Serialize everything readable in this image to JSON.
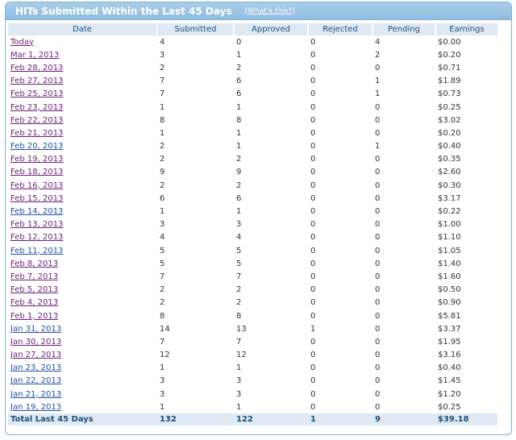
{
  "panel": {
    "title": "HITs Submitted Within the Last 45 Days",
    "whats_this": "(What's this?)"
  },
  "table": {
    "headers": [
      "Date",
      "Submitted",
      "Approved",
      "Rejected",
      "Pending",
      "Earnings"
    ],
    "rows": [
      {
        "date": "Today",
        "submitted": "4",
        "approved": "0",
        "rejected": "0",
        "pending": "4",
        "earnings": "$0.00"
      },
      {
        "date": "Mar 1, 2013",
        "submitted": "3",
        "approved": "1",
        "rejected": "0",
        "pending": "2",
        "earnings": "$0.20"
      },
      {
        "date": "Feb 28, 2013",
        "submitted": "2",
        "approved": "2",
        "rejected": "0",
        "pending": "0",
        "earnings": "$0.71"
      },
      {
        "date": "Feb 27, 2013",
        "submitted": "7",
        "approved": "6",
        "rejected": "0",
        "pending": "1",
        "earnings": "$1.89"
      },
      {
        "date": "Feb 25, 2013",
        "submitted": "7",
        "approved": "6",
        "rejected": "0",
        "pending": "1",
        "earnings": "$0.73"
      },
      {
        "date": "Feb 23, 2013",
        "submitted": "1",
        "approved": "1",
        "rejected": "0",
        "pending": "0",
        "earnings": "$0.25"
      },
      {
        "date": "Feb 22, 2013",
        "submitted": "8",
        "approved": "8",
        "rejected": "0",
        "pending": "0",
        "earnings": "$3.02"
      },
      {
        "date": "Feb 21, 2013",
        "submitted": "1",
        "approved": "1",
        "rejected": "0",
        "pending": "0",
        "earnings": "$0.20"
      },
      {
        "date": "Feb 20, 2013",
        "submitted": "2",
        "approved": "1",
        "rejected": "0",
        "pending": "1",
        "earnings": "$0.40"
      },
      {
        "date": "Feb 19, 2013",
        "submitted": "2",
        "approved": "2",
        "rejected": "0",
        "pending": "0",
        "earnings": "$0.35"
      },
      {
        "date": "Feb 18, 2013",
        "submitted": "9",
        "approved": "9",
        "rejected": "0",
        "pending": "0",
        "earnings": "$2.60"
      },
      {
        "date": "Feb 16, 2013",
        "submitted": "2",
        "approved": "2",
        "rejected": "0",
        "pending": "0",
        "earnings": "$0.30"
      },
      {
        "date": "Feb 15, 2013",
        "submitted": "6",
        "approved": "6",
        "rejected": "0",
        "pending": "0",
        "earnings": "$3.17"
      },
      {
        "date": "Feb 14, 2013",
        "submitted": "1",
        "approved": "1",
        "rejected": "0",
        "pending": "0",
        "earnings": "$0.22"
      },
      {
        "date": "Feb 13, 2013",
        "submitted": "3",
        "approved": "3",
        "rejected": "0",
        "pending": "0",
        "earnings": "$1.00"
      },
      {
        "date": "Feb 12, 2013",
        "submitted": "4",
        "approved": "4",
        "rejected": "0",
        "pending": "0",
        "earnings": "$1.10"
      },
      {
        "date": "Feb 11, 2013",
        "submitted": "5",
        "approved": "5",
        "rejected": "0",
        "pending": "0",
        "earnings": "$1.05"
      },
      {
        "date": "Feb 8, 2013",
        "submitted": "5",
        "approved": "5",
        "rejected": "0",
        "pending": "0",
        "earnings": "$1.40"
      },
      {
        "date": "Feb 7, 2013",
        "submitted": "7",
        "approved": "7",
        "rejected": "0",
        "pending": "0",
        "earnings": "$1.60"
      },
      {
        "date": "Feb 5, 2013",
        "submitted": "2",
        "approved": "2",
        "rejected": "0",
        "pending": "0",
        "earnings": "$0.50"
      },
      {
        "date": "Feb 4, 2013",
        "submitted": "2",
        "approved": "2",
        "rejected": "0",
        "pending": "0",
        "earnings": "$0.90"
      },
      {
        "date": "Feb 1, 2013",
        "submitted": "8",
        "approved": "8",
        "rejected": "0",
        "pending": "0",
        "earnings": "$5.81"
      },
      {
        "date": "Jan 31, 2013",
        "submitted": "14",
        "approved": "13",
        "rejected": "1",
        "pending": "0",
        "earnings": "$3.37"
      },
      {
        "date": "Jan 30, 2013",
        "submitted": "7",
        "approved": "7",
        "rejected": "0",
        "pending": "0",
        "earnings": "$1.95"
      },
      {
        "date": "Jan 27, 2013",
        "submitted": "12",
        "approved": "12",
        "rejected": "0",
        "pending": "0",
        "earnings": "$3.16"
      },
      {
        "date": "Jan 23, 2013",
        "submitted": "1",
        "approved": "1",
        "rejected": "0",
        "pending": "0",
        "earnings": "$0.40"
      },
      {
        "date": "Jan 22, 2013",
        "submitted": "3",
        "approved": "3",
        "rejected": "0",
        "pending": "0",
        "earnings": "$1.45"
      },
      {
        "date": "Jan 21, 2013",
        "submitted": "3",
        "approved": "3",
        "rejected": "0",
        "pending": "0",
        "earnings": "$1.20"
      },
      {
        "date": "Jan 19, 2013",
        "submitted": "1",
        "approved": "1",
        "rejected": "0",
        "pending": "0",
        "earnings": "$0.25"
      }
    ],
    "total": {
      "label": "Total Last 45 Days",
      "submitted": "132",
      "approved": "122",
      "rejected": "1",
      "pending": "9",
      "earnings": "$39.18"
    }
  },
  "colors": {
    "header_bg": "#8fbde0",
    "column_header_bg": "#dfe9f3",
    "visited_link": "#6b1f7a",
    "unvisited_link": "#1f4fa8"
  }
}
